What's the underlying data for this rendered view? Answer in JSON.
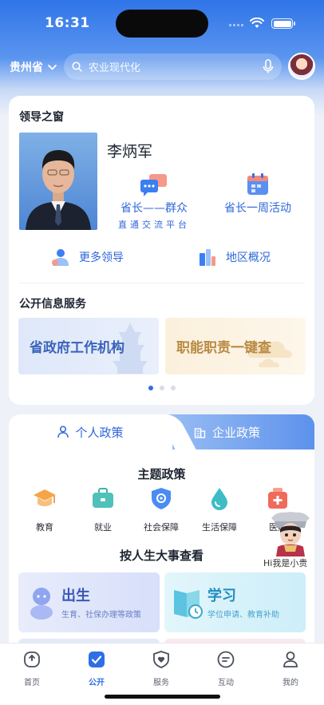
{
  "status_bar": {
    "time": "16:31"
  },
  "header": {
    "region": "贵州省",
    "search_placeholder": "农业现代化"
  },
  "leader_window": {
    "title": "领导之窗",
    "leader_name": "李炳军",
    "features": [
      {
        "label": "省长——群众",
        "sub": "直通交流平台",
        "icon": "chat-bubbles-icon"
      },
      {
        "label": "省长一周活动",
        "sub": "",
        "icon": "calendar-icon"
      }
    ],
    "links": [
      {
        "label": "更多领导",
        "icon": "person-icon"
      },
      {
        "label": "地区概况",
        "icon": "buildings-icon"
      }
    ]
  },
  "public_info": {
    "title": "公开信息服务",
    "tiles": [
      "省政府工作机构",
      "职能职责一键查"
    ],
    "carousel": {
      "total": 3,
      "active": 1
    }
  },
  "policy": {
    "tabs": [
      {
        "label": "个人政策",
        "active": true,
        "icon": "person-outline-icon"
      },
      {
        "label": "企业政策",
        "active": false,
        "icon": "building-icon"
      }
    ],
    "theme_title": "主题政策",
    "themes": [
      {
        "label": "教育",
        "icon": "graduation-cap-icon"
      },
      {
        "label": "就业",
        "icon": "briefcase-icon"
      },
      {
        "label": "社会保障",
        "icon": "shield-icon"
      },
      {
        "label": "生活保障",
        "icon": "water-drop-icon"
      },
      {
        "label": "医疗",
        "icon": "medical-kit-icon"
      }
    ],
    "life_title": "按人生大事查看",
    "life_events": [
      {
        "title": "出生",
        "sub": "生育、社保办理等政策"
      },
      {
        "title": "学习",
        "sub": "学位申请、教育补助"
      }
    ]
  },
  "assistant": {
    "label": "Hi我是小贵"
  },
  "bottom_nav": [
    {
      "label": "首页",
      "icon": "home-icon",
      "active": false
    },
    {
      "label": "公开",
      "icon": "check-square-icon",
      "active": true
    },
    {
      "label": "服务",
      "icon": "heart-shield-icon",
      "active": false
    },
    {
      "label": "互动",
      "icon": "chat-icon",
      "active": false
    },
    {
      "label": "我的",
      "icon": "user-icon",
      "active": false
    }
  ],
  "colors": {
    "primary": "#2f6fe6",
    "header_blue": "#2f74e8",
    "link_blue": "#2f67d8"
  }
}
